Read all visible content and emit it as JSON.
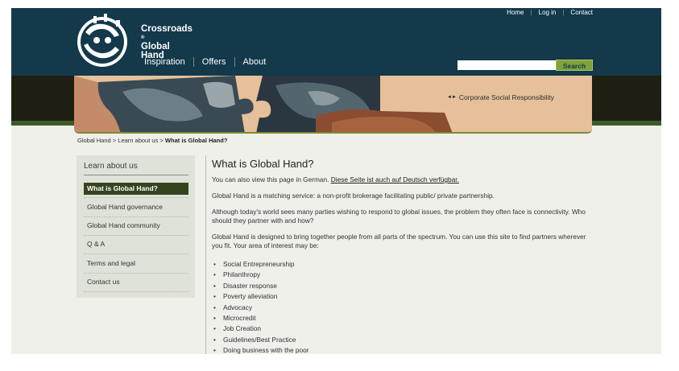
{
  "brand": {
    "logo_name": "Crossroads",
    "logo_mark": "®",
    "line2": "Global",
    "line3": "Hand"
  },
  "top_nav": [
    "Home",
    "Log in",
    "Contact"
  ],
  "main_nav": [
    "Inspiration",
    "Offers",
    "About"
  ],
  "search": {
    "placeholder": "",
    "button_label": "Search"
  },
  "banner": {
    "link_text": "Corporate Social Responsibility"
  },
  "breadcrumb": {
    "part1": "Global Hand",
    "part2": "Learn about us",
    "current": "What is Global Hand?",
    "separator": ">"
  },
  "sidebar": {
    "title": "Learn about us",
    "items": [
      "What is Global Hand?",
      "Global Hand governance",
      "Global Hand community",
      "Q & A",
      "Terms and legal",
      "Contact us"
    ]
  },
  "content": {
    "heading": "What is Global Hand?",
    "german_note": "You can also view this page in German.",
    "german_link": "Diese Seite ist auch auf Deutsch verfügbar.",
    "p1": "Global Hand is a matching service: a non-profit brokerage facilitating public/ private partnership.",
    "p2": "Although today's world sees many parties wishing to respond to global issues, the problem they often face is connectivity. Who should they partner with and how?",
    "p3": "Global Hand is designed to bring together people from all parts of the spectrum. You can use this site to find partners wherever you fit. Your area of interest may be:",
    "interests": [
      "Social Entrepreneurship",
      "Philanthropy",
      "Disaster response",
      "Poverty alleviation",
      "Advocacy",
      "Microcredit",
      "Job Creation",
      "Guidelines/Best Practice",
      "Doing business with the poor"
    ]
  },
  "colors": {
    "header_bg": "#13394b",
    "search_button": "#7fa23a",
    "sidebar_active": "#35441f",
    "page_bg": "#eef0e9"
  }
}
